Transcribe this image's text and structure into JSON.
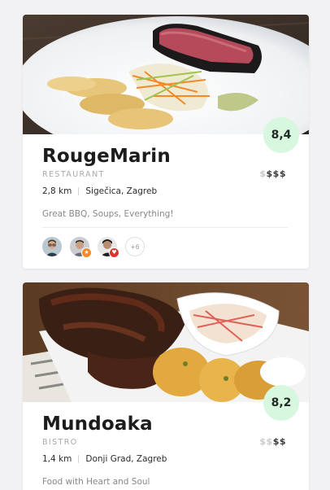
{
  "listings": [
    {
      "name": "RougeMarin",
      "type": "RESTAURANT",
      "score": "8,4",
      "price_active": "$",
      "price_inactive": "$$$",
      "distance": "2,8 km",
      "area": "Sigečica, Zagreb",
      "description": "Great BBQ, Soups, Everything!",
      "reviewers_more": "+6",
      "reviewers": [
        {
          "icon": "avatar-man-glasses",
          "badge": ""
        },
        {
          "icon": "avatar-man-badge-orange",
          "badge": "★"
        },
        {
          "icon": "avatar-man-badge-red",
          "badge": "♥"
        }
      ],
      "colors": {
        "score_bg": "#d7f7df"
      }
    },
    {
      "name": "Mundoaka",
      "type": "BISTRO",
      "score": "8,2",
      "price_active": "$$",
      "price_inactive": "$$",
      "distance": "1,4 km",
      "area": "Donji Grad, Zagreb",
      "description": "Food with Heart and Soul",
      "colors": {
        "score_bg": "#d7f7df"
      }
    }
  ]
}
